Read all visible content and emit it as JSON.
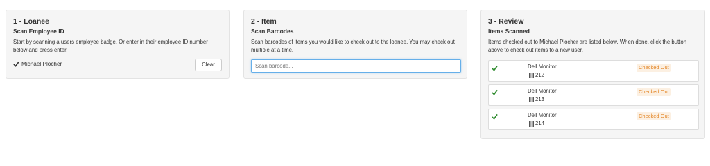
{
  "loanee": {
    "title": "1 - Loanee",
    "subtitle": "Scan Employee ID",
    "description": "Start by scanning a users employee badge. Or enter in their employee ID number below and press enter.",
    "selected_name": "Michael Plocher",
    "clear_label": "Clear"
  },
  "item": {
    "title": "2 - Item",
    "subtitle": "Scan Barcodes",
    "description": "Scan barcodes of items you would like to check out to the loanee. You may check out multiple at a time.",
    "input_value": "",
    "input_placeholder": "Scan barcode..."
  },
  "review": {
    "title": "3 - Review",
    "subtitle": "Items Scanned",
    "description": "Items checked out to Michael Plocher are listed below. When done, click the button above to check out items to a new user.",
    "items": [
      {
        "name": "Dell Monitor",
        "tag": "212",
        "status": "Checked Out"
      },
      {
        "name": "Dell Monitor",
        "tag": "213",
        "status": "Checked Out"
      },
      {
        "name": "Dell Monitor",
        "tag": "214",
        "status": "Checked Out"
      }
    ]
  },
  "icons": {
    "check": "check-icon",
    "barcode": "barcode-icon"
  },
  "colors": {
    "check": "#2e8b2e",
    "status_text": "#e4882b",
    "status_bg": "#fcf0e2",
    "input_focus": "#66afe9",
    "panel_bg": "#f5f5f5"
  }
}
